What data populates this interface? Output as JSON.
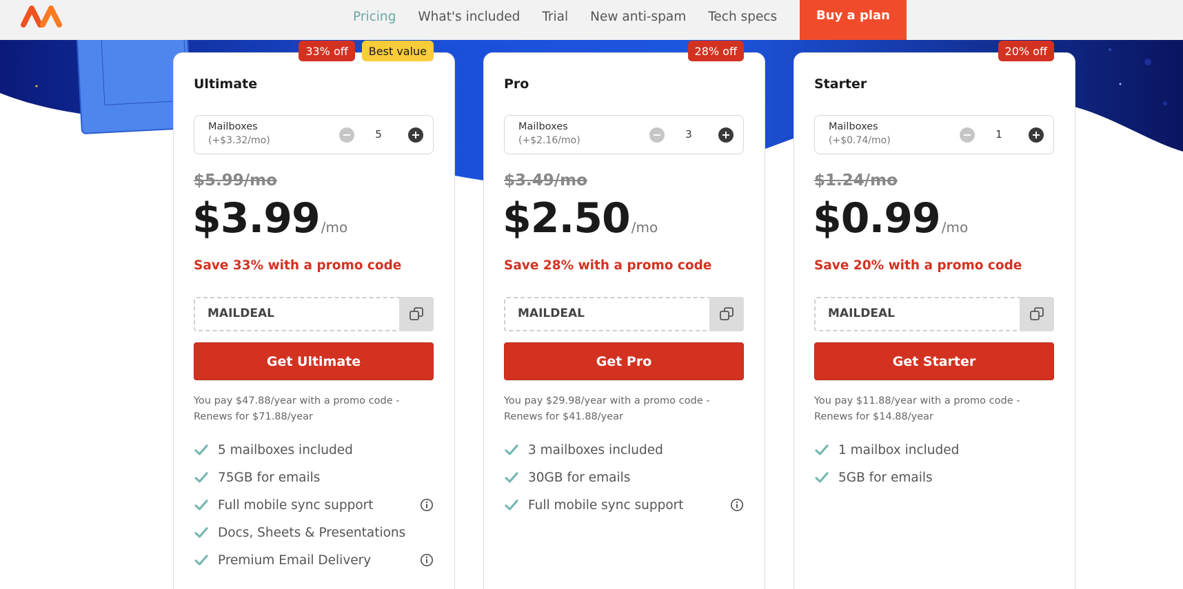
{
  "header": {
    "logo": "namecheap-logo",
    "nav": [
      "Pricing",
      "What's included",
      "Trial",
      "New anti-spam",
      "Tech specs"
    ],
    "buy_button": "Buy a plan"
  },
  "colors": {
    "accent": "#d33221",
    "buy_button": "#f04c2c",
    "nav_active": "#6aaaa3",
    "best_value_badge": "#fbcc3a",
    "hero_blue": "#1a4fd8"
  },
  "plans": [
    {
      "name": "Ultimate",
      "badges": {
        "off": "33% off",
        "best": "Best value"
      },
      "mailboxes_label": "Mailboxes",
      "mailbox_price": "(+$3.32/mo)",
      "mailbox_count": "5",
      "old_price": "$5.99/mo",
      "price": "$3.99",
      "per": "/mo",
      "save_text": "Save 33% with a promo code",
      "promo_code": "MAILDEAL",
      "cta": "Get Ultimate",
      "pay_note": "You pay $47.88/year with a promo code - Renews for $71.88/year",
      "features": [
        {
          "text": "5 mailboxes included"
        },
        {
          "text": "75GB for emails"
        },
        {
          "text": "Full mobile sync support",
          "info": true
        },
        {
          "text": "Docs, Sheets & Presentations"
        },
        {
          "text": "Premium Email Delivery",
          "info": true
        }
      ]
    },
    {
      "name": "Pro",
      "badges": {
        "off": "28% off"
      },
      "mailboxes_label": "Mailboxes",
      "mailbox_price": "(+$2.16/mo)",
      "mailbox_count": "3",
      "old_price": "$3.49/mo",
      "price": "$2.50",
      "per": "/mo",
      "save_text": "Save 28% with a promo code",
      "promo_code": "MAILDEAL",
      "cta": "Get Pro",
      "pay_note": "You pay $29.98/year with a promo code - Renews for $41.88/year",
      "features": [
        {
          "text": "3 mailboxes included"
        },
        {
          "text": "30GB for emails"
        },
        {
          "text": "Full mobile sync support",
          "info": true
        }
      ]
    },
    {
      "name": "Starter",
      "badges": {
        "off": "20% off"
      },
      "mailboxes_label": "Mailboxes",
      "mailbox_price": "(+$0.74/mo)",
      "mailbox_count": "1",
      "old_price": "$1.24/mo",
      "price": "$0.99",
      "per": "/mo",
      "save_text": "Save 20% with a promo code",
      "promo_code": "MAILDEAL",
      "cta": "Get Starter",
      "pay_note": "You pay $11.88/year with a promo code - Renews for $14.88/year",
      "features": [
        {
          "text": "1 mailbox included"
        },
        {
          "text": "5GB for emails"
        }
      ]
    }
  ]
}
